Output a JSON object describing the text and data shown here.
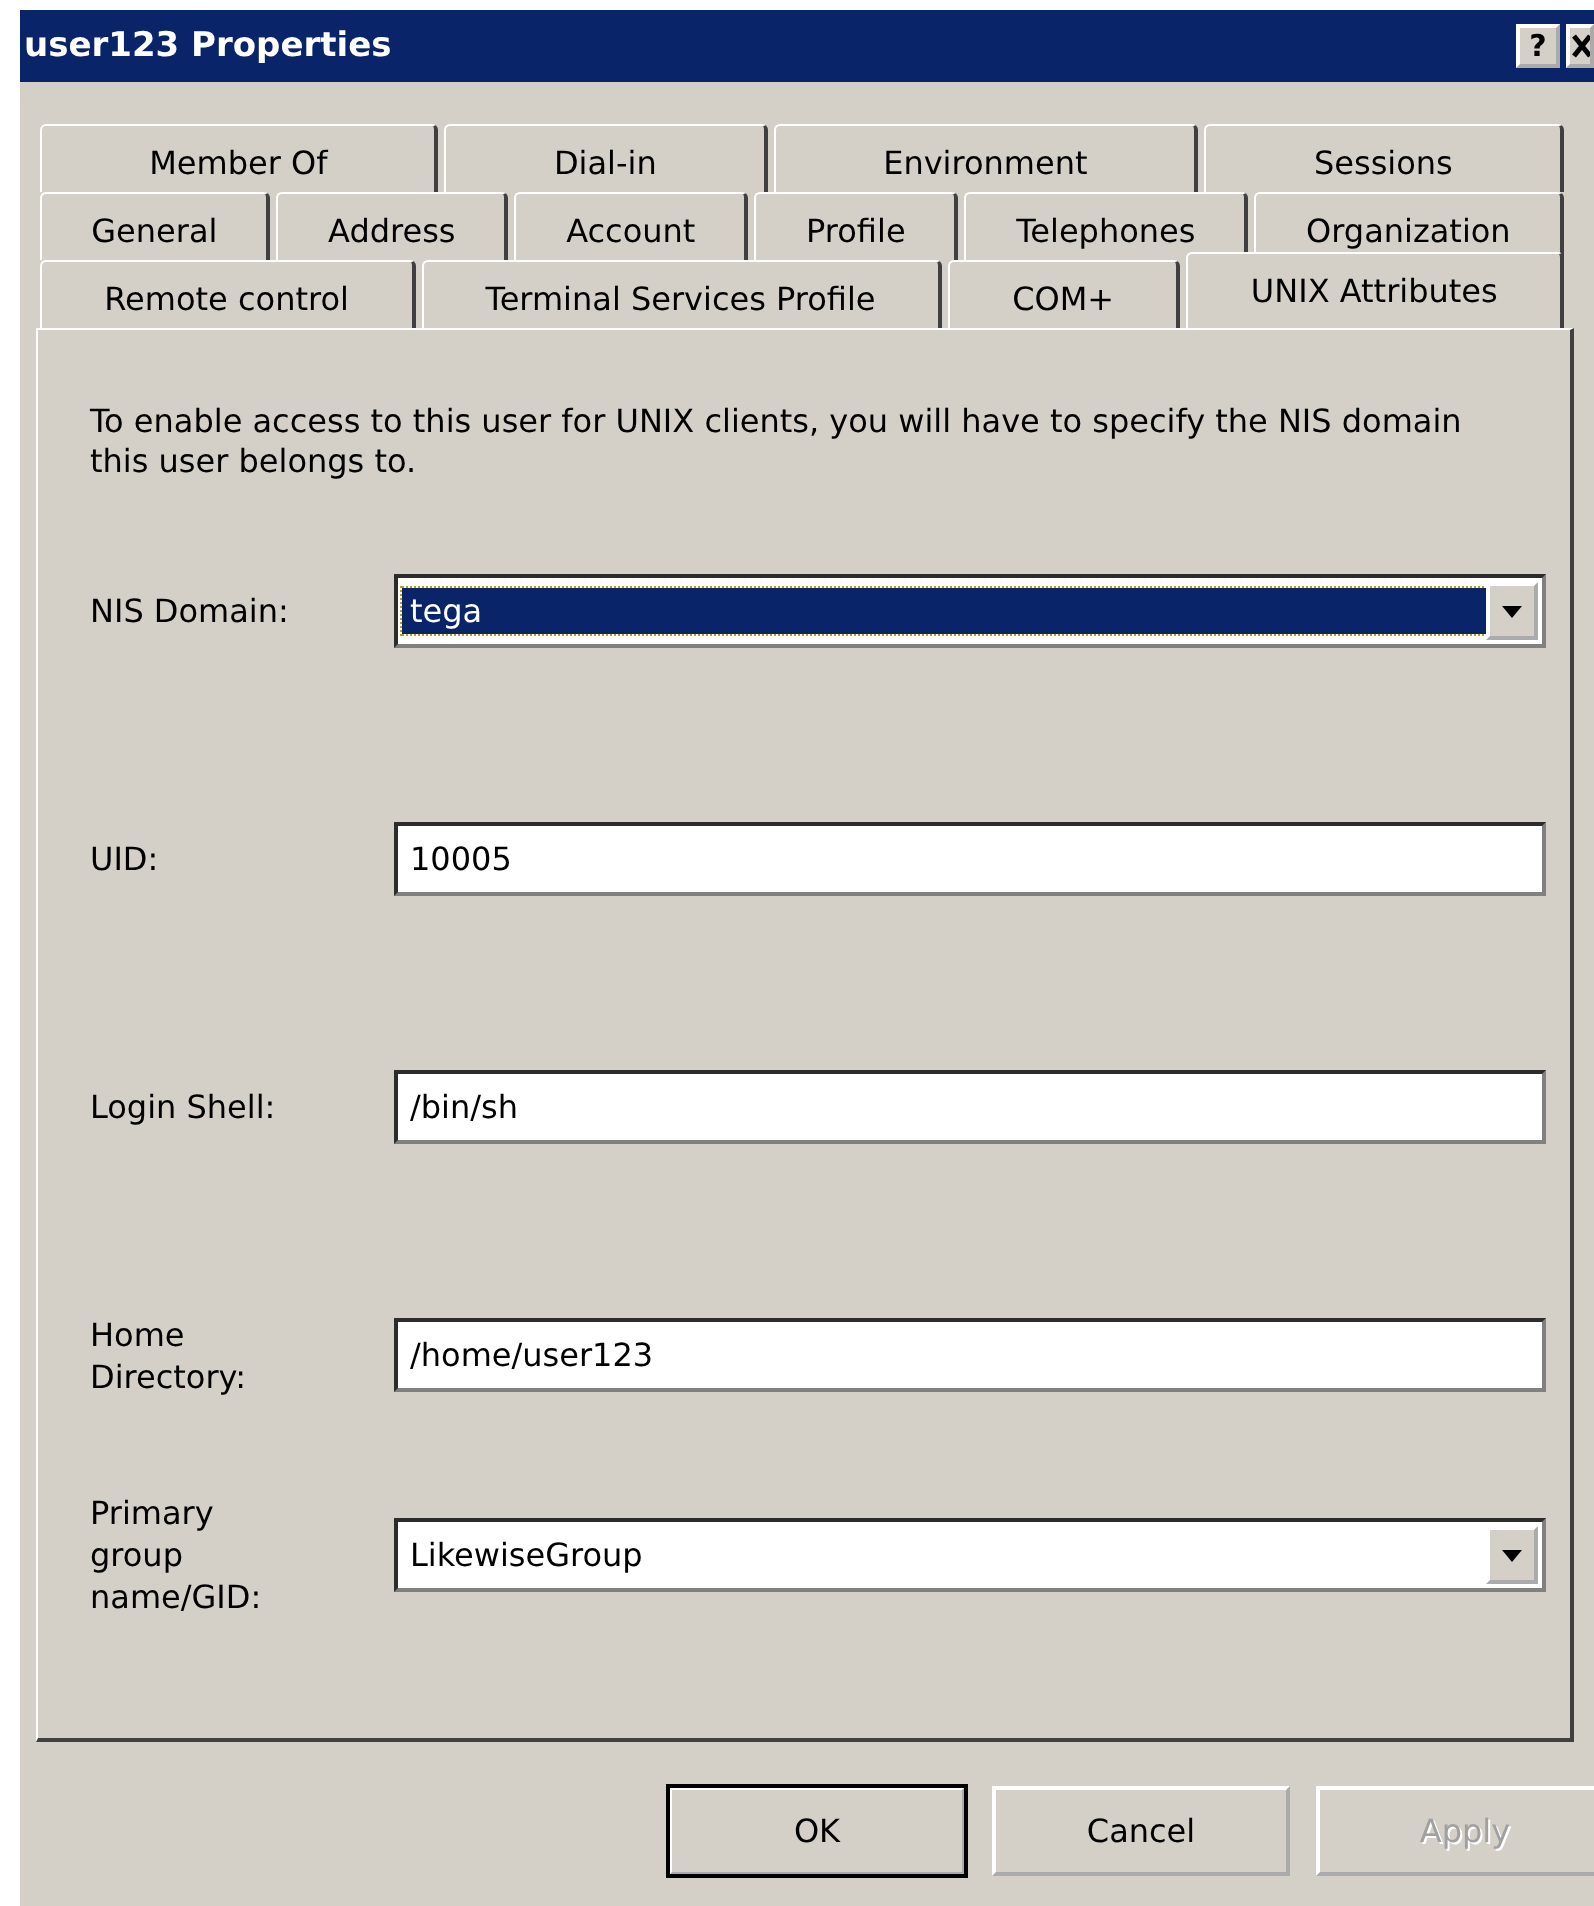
{
  "window": {
    "title": "user123 Properties",
    "help_button": "?"
  },
  "tab_rows": [
    [
      {
        "label": "Member Of",
        "selected": false
      },
      {
        "label": "Dial-in",
        "selected": false
      },
      {
        "label": "Environment",
        "selected": false
      },
      {
        "label": "Sessions",
        "selected": false
      }
    ],
    [
      {
        "label": "General",
        "selected": false
      },
      {
        "label": "Address",
        "selected": false
      },
      {
        "label": "Account",
        "selected": false
      },
      {
        "label": "Profile",
        "selected": false
      },
      {
        "label": "Telephones",
        "selected": false
      },
      {
        "label": "Organization",
        "selected": false
      }
    ],
    [
      {
        "label": "Remote control",
        "selected": false
      },
      {
        "label": "Terminal Services Profile",
        "selected": false
      },
      {
        "label": "COM+",
        "selected": false
      },
      {
        "label": "UNIX Attributes",
        "selected": true
      }
    ]
  ],
  "description": "To enable access to this user for UNIX clients, you will have to specify the NIS domain this user belongs to.",
  "fields": [
    {
      "label": "NIS Domain:",
      "kind": "combo",
      "value": "tega",
      "highlighted": true
    },
    {
      "label": "UID:",
      "kind": "text",
      "value": "10005",
      "highlighted": false
    },
    {
      "label": "Login Shell:",
      "kind": "text",
      "value": "/bin/sh",
      "highlighted": false
    },
    {
      "label": "Home Directory:",
      "kind": "text",
      "value": "/home/user123",
      "highlighted": false
    },
    {
      "label": "Primary group name/GID:",
      "kind": "combo",
      "value": "LikewiseGroup",
      "highlighted": false
    }
  ],
  "buttons": [
    {
      "label": "OK",
      "default": true,
      "disabled": false
    },
    {
      "label": "Cancel",
      "default": false,
      "disabled": false
    },
    {
      "label": "Apply",
      "default": false,
      "disabled": true
    }
  ]
}
